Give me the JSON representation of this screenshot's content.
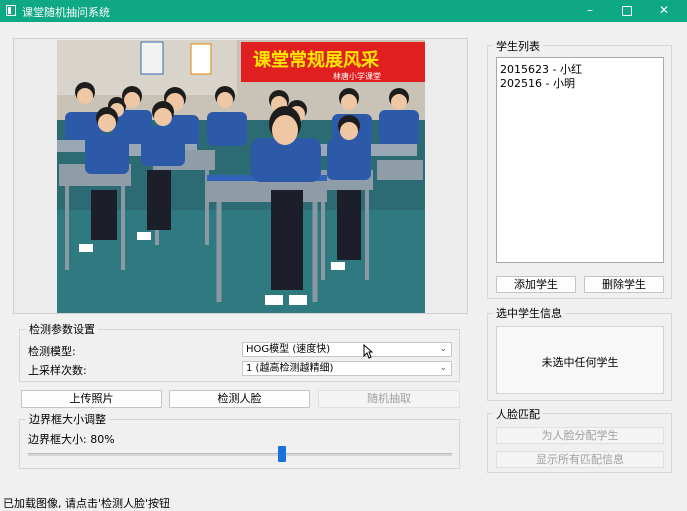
{
  "window": {
    "title": "课堂随机抽问系统",
    "minimize_icon": "minimize-icon",
    "maximize_icon": "maximize-icon",
    "close_icon": "close-icon"
  },
  "photo": {
    "banner_text": "课堂常规展风采",
    "banner_subtext": "林唐小学课堂"
  },
  "detect_params": {
    "title": "检测参数设置",
    "model_label": "检测模型:",
    "model_value": "HOG模型 (速度快)",
    "upsample_label": "上采样次数:",
    "upsample_value": "1 (越高检测越精细)"
  },
  "actions": {
    "upload": "上传照片",
    "detect": "检测人脸",
    "random_pick": "随机抽取"
  },
  "bbox_adjust": {
    "title": "边界框大小调整",
    "label": "边界框大小: 80%",
    "value_percent": 80
  },
  "student_list": {
    "title": "学生列表",
    "items": [
      "2015623 - 小红",
      "202516 - 小明"
    ],
    "add_button": "添加学生",
    "delete_button": "删除学生"
  },
  "selected_student": {
    "title": "选中学生信息",
    "text": "未选中任何学生"
  },
  "face_match": {
    "title": "人脸匹配",
    "assign_button": "为人脸分配学生",
    "show_all_button": "显示所有匹配信息"
  },
  "status": {
    "text": "已加载图像, 请点击'检测人脸'按钮"
  },
  "colors": {
    "titlebar": "#0fa884",
    "slider_handle": "#1a73d9",
    "banner_red": "#e02020",
    "banner_text": "#ffe600"
  }
}
